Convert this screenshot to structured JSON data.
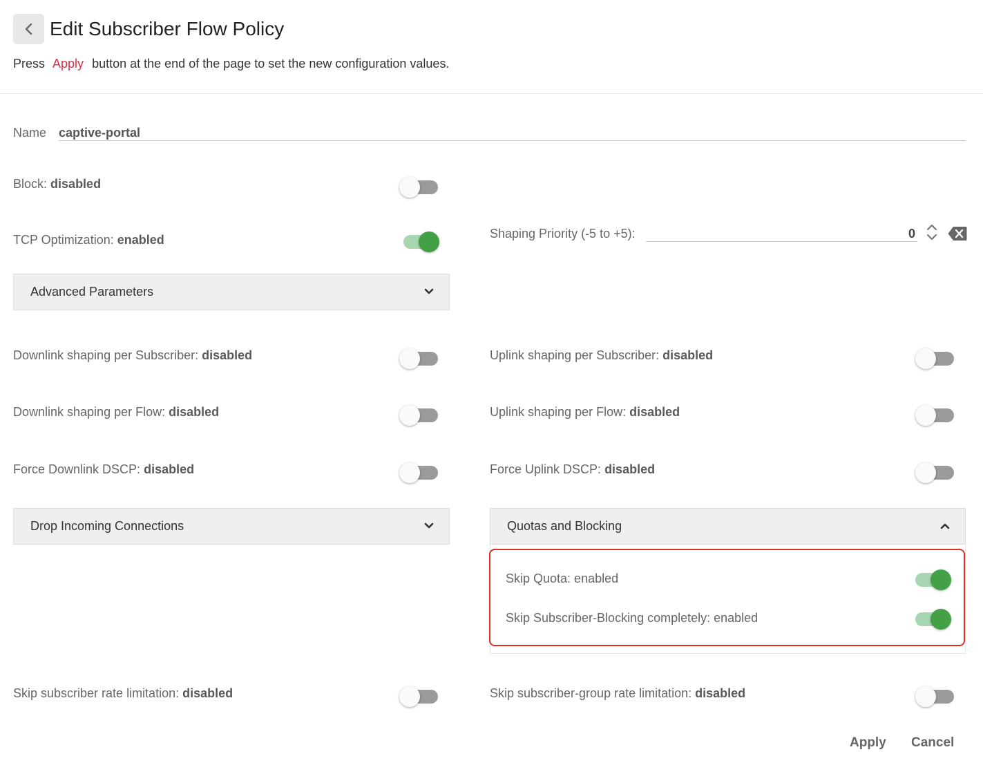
{
  "header": {
    "title": "Edit Subscriber Flow Policy",
    "hint_before": "Press",
    "hint_link": "Apply",
    "hint_after": "button at the end of the page to set the new configuration values."
  },
  "name_field": {
    "label": "Name",
    "value": "captive-portal"
  },
  "block": {
    "label": "Block:",
    "state": "disabled",
    "on": false
  },
  "tcp_optimization": {
    "label": "TCP Optimization:",
    "state": "enabled",
    "on": true
  },
  "shaping_priority": {
    "label": "Shaping Priority (-5 to +5):",
    "value": "0"
  },
  "advanced_parameters_panel": {
    "label": "Advanced Parameters",
    "expanded": false
  },
  "downlink_shaping_subscriber": {
    "label": "Downlink shaping per Subscriber:",
    "state": "disabled",
    "on": false
  },
  "uplink_shaping_subscriber": {
    "label": "Uplink shaping per Subscriber:",
    "state": "disabled",
    "on": false
  },
  "downlink_shaping_flow": {
    "label": "Downlink shaping per Flow:",
    "state": "disabled",
    "on": false
  },
  "uplink_shaping_flow": {
    "label": "Uplink shaping per Flow:",
    "state": "disabled",
    "on": false
  },
  "force_downlink_dscp": {
    "label": "Force Downlink DSCP:",
    "state": "disabled",
    "on": false
  },
  "force_uplink_dscp": {
    "label": "Force Uplink DSCP:",
    "state": "disabled",
    "on": false
  },
  "drop_incoming_panel": {
    "label": "Drop Incoming Connections",
    "expanded": false
  },
  "quotas_panel": {
    "label": "Quotas and Blocking",
    "expanded": true,
    "skip_quota": {
      "label": "Skip Quota: enabled",
      "on": true
    },
    "skip_subscriber_blocking": {
      "label": "Skip Subscriber-Blocking completely: enabled",
      "on": true
    }
  },
  "skip_subscriber_rate": {
    "label": "Skip subscriber rate limitation:",
    "state": "disabled",
    "on": false
  },
  "skip_subscriber_group_rate": {
    "label": "Skip subscriber-group rate limitation:",
    "state": "disabled",
    "on": false
  },
  "footer": {
    "apply": "Apply",
    "cancel": "Cancel"
  },
  "colors": {
    "accent_link": "#d9304a",
    "toggle_on": "#43a047",
    "toggle_off_track": "#9a9a9a",
    "highlight_border": "#d93025"
  },
  "icons": {
    "back": "chevron-left-icon",
    "collapse": "chevron-up-icon",
    "expand": "chevron-down-icon",
    "spin": "spinner-arrows-icon",
    "clear": "backspace-clear-icon"
  }
}
